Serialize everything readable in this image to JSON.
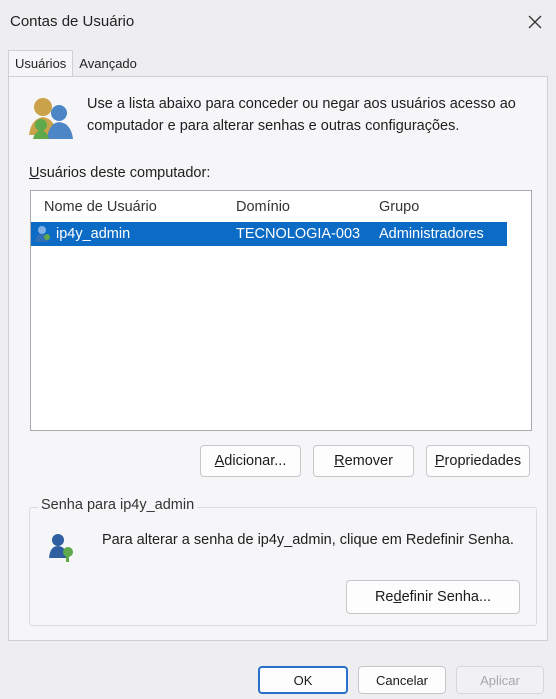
{
  "window": {
    "title": "Contas de Usuário"
  },
  "tabs": [
    {
      "label": "Usuários",
      "active": true
    },
    {
      "label": "Avançado",
      "active": false
    }
  ],
  "intro": {
    "text": "Use a lista abaixo para conceder ou negar aos usuários acesso ao computador e para alterar senhas e outras configurações."
  },
  "users_section": {
    "label_underlined": "U",
    "label_rest": "suários deste computador:",
    "columns": [
      "Nome de Usuário",
      "Domínio",
      "Grupo"
    ],
    "rows": [
      {
        "name": "ip4y_admin",
        "domain": "TECNOLOGIA-003",
        "group": "Administradores",
        "selected": true
      }
    ]
  },
  "actions": {
    "add_ul": "A",
    "add_rest": "dicionar...",
    "remove_ul": "R",
    "remove_rest": "emover",
    "props_ul": "P",
    "props_rest": "ropriedades"
  },
  "password_group": {
    "title": "Senha para ip4y_admin",
    "text": "Para alterar a senha de ip4y_admin, clique em Redefinir Senha.",
    "reset_pre": "Re",
    "reset_ul": "d",
    "reset_rest": "efinir Senha..."
  },
  "footer": {
    "ok": "OK",
    "cancel": "Cancelar",
    "apply": "Aplicar"
  },
  "colors": {
    "selection": "#0c6bc4",
    "default_button_border": "#2a6fc9"
  }
}
